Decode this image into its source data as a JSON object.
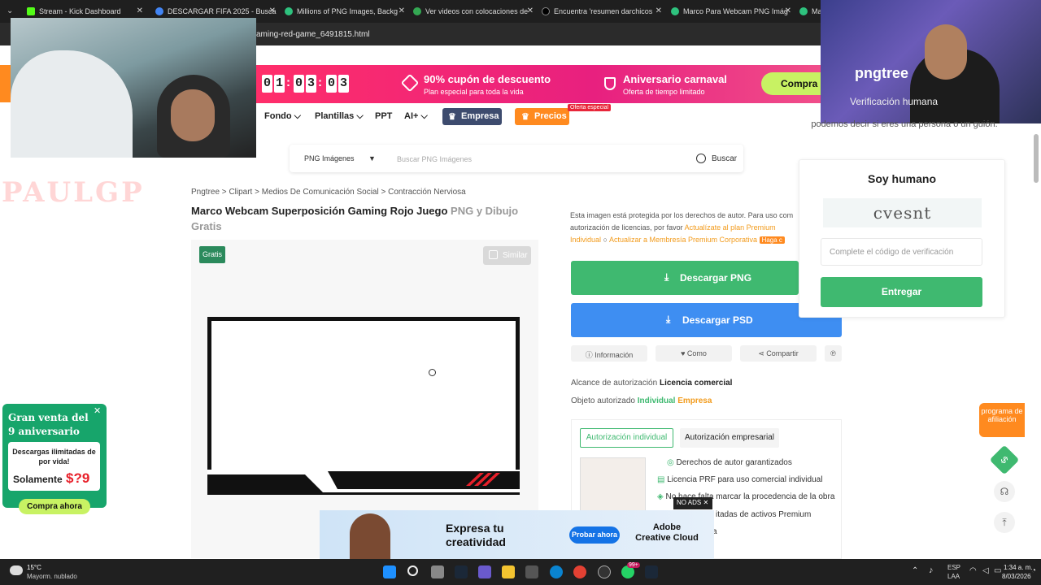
{
  "browser": {
    "tabs": [
      {
        "title": "Stream - Kick Dashboard",
        "color": "#53fc18"
      },
      {
        "title": "DESCARGAR FIFA 2025 - Busca",
        "color": "#4285f4"
      },
      {
        "title": "Millions of PNG Images, Backg",
        "color": "#2ec27e"
      },
      {
        "title": "Ver videos con colocaciones de",
        "color": "#34a853"
      },
      {
        "title": "Encuentra 'resumen darchicos",
        "color": "#000000"
      },
      {
        "title": "Marco Para Webcam PNG Imág",
        "color": "#2ec27e"
      },
      {
        "title": "Ma",
        "color": "#2ec27e"
      }
    ],
    "url": "aming-red-game_6491815.html"
  },
  "webcam2": {
    "logo": "pngtree",
    "caption": "Verificación humana"
  },
  "promo": {
    "timer": [
      "0",
      "1",
      "0",
      "3",
      "0",
      "3"
    ],
    "coupon_title": "90% cupón de descuento",
    "coupon_sub": "Plan especial para toda la vida",
    "anniv_title": "Aniversario carnaval",
    "anniv_sub": "Oferta de tiempo limitado",
    "buy": "Compra a"
  },
  "nav": {
    "fondo": "Fondo",
    "plantillas": "Plantillas",
    "ppt": "PPT",
    "ai": "AI+",
    "empresa": "Empresa",
    "precios": "Precios",
    "oferta": "Oferta especial"
  },
  "search": {
    "category": "PNG Imágenes",
    "placeholder": "Buscar PNG Imágenes",
    "button": "Buscar"
  },
  "decor_text": "PAULGP",
  "breadcrumb": [
    "Pngtree",
    "Clipart",
    "Medios De Comunicación Social",
    "Contracción Nerviosa"
  ],
  "title": {
    "bold": "Marco Webcam Superposición Gaming Rojo Juego",
    "light": "PNG y Dibujo Gratis"
  },
  "image": {
    "badge": "Gratis",
    "similar": "Similar"
  },
  "copyright": {
    "text1": "Esta imagen está protegida por los derechos de autor. Para uso com",
    "text2": "autorización de licencias, por favor",
    "link1": "Actualízate al plan Premium Individual",
    "link2": "Actualizar a Membresía Premium Corporativa",
    "haga": "Haga c"
  },
  "download": {
    "png": "Descargar PNG",
    "psd": "Descargar PSD"
  },
  "actions": {
    "info": "Información",
    "like": "Como",
    "share": "Compartir"
  },
  "license": {
    "scope_label": "Alcance de autorización",
    "scope_value": "Licencia comercial",
    "object_label": "Objeto autorizado",
    "object_ind": "Individual",
    "object_emp": "Empresa",
    "tab_ind": "Autorización individual",
    "tab_emp": "Autorización empresarial",
    "features": [
      "Derechos de autor garantizados",
      "Licencia PRF para uso comercial individual",
      "No hace falta marcar la procedencia de la obra",
      "itadas de activos Premium",
      "a"
    ]
  },
  "captcha": {
    "note1": "podemos decir si eres una persona o un guión.",
    "title": "Soy humano",
    "code": "cvesnt",
    "placeholder": "Complete el código de verificación",
    "submit": "Entregar"
  },
  "side": {
    "afiliacion": "programa de afiliación"
  },
  "sale": {
    "title": "Gran venta del 9 aniversario",
    "line1": "Descargas ilimitadas de por vida!",
    "price_label": "Solamente",
    "price": "$?9",
    "buy": "Compra ahora"
  },
  "ad": {
    "headline1": "Expresa tu",
    "headline2": "creatividad",
    "cta": "Probar ahora",
    "brand1": "Adobe",
    "brand2": "Creative Cloud",
    "noads": "NO ADS"
  },
  "taskbar": {
    "temp": "15°C",
    "weather": "Mayorm. nublado",
    "lang1": "ESP",
    "lang2": "LAA",
    "time": "1:34 a. m.",
    "date": "8/03/2026",
    "badge": "99+"
  }
}
